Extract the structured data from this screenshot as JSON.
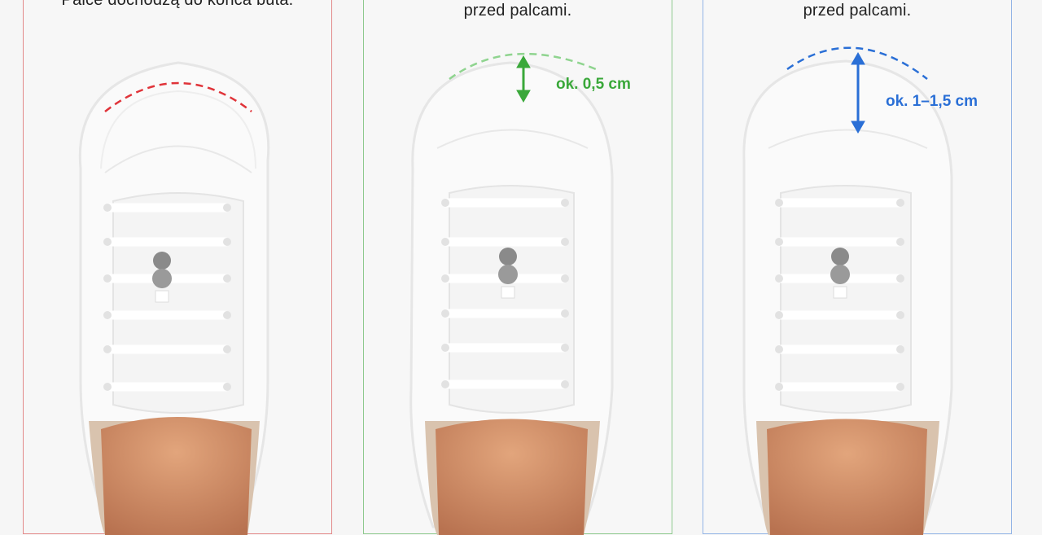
{
  "panels": [
    {
      "caption": "Palce dochodzą do końca buta.",
      "outline_color": "#e0343a",
      "measurement": ""
    },
    {
      "caption": "przed palcami.",
      "outline_color": "#35a135",
      "measurement": "ok. 0,5 cm"
    },
    {
      "caption": "przed palcami.",
      "outline_color": "#2a6fd6",
      "measurement": "ok. 1–1,5 cm"
    }
  ]
}
